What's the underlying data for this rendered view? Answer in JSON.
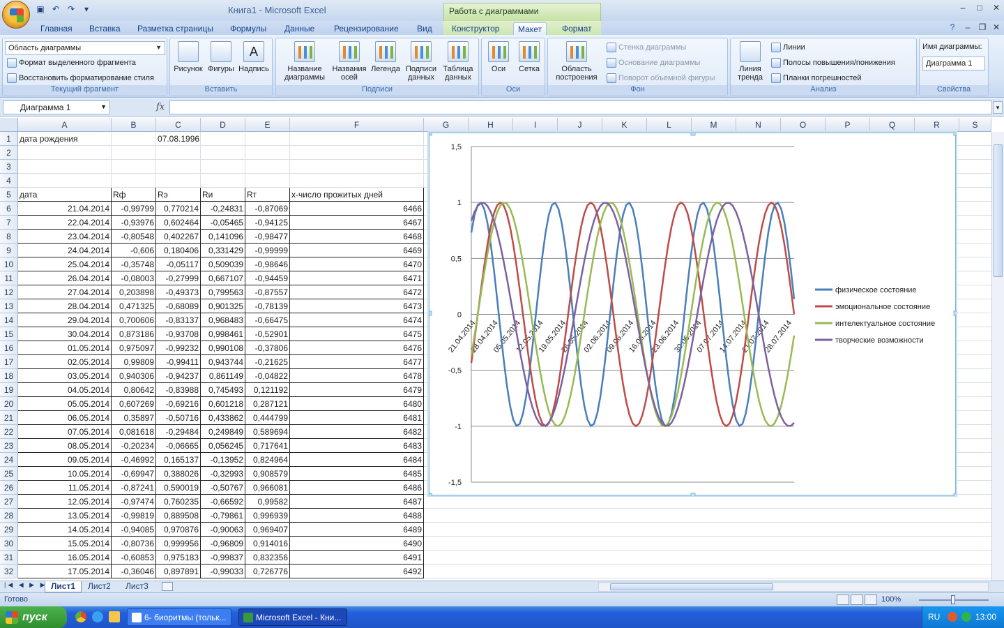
{
  "window": {
    "title": "Книга1 - Microsoft Excel",
    "context_group": "Работа с диаграммами"
  },
  "tabs": [
    "Главная",
    "Вставка",
    "Разметка страницы",
    "Формулы",
    "Данные",
    "Рецензирование",
    "Вид",
    "Конструктор",
    "Макет",
    "Формат"
  ],
  "active_tab": "Макет",
  "ribbon": {
    "current": {
      "selector_value": "Область диаграммы",
      "format_selection": "Формат выделенного фрагмента",
      "reset_style": "Восстановить форматирование стиля",
      "label": "Текущий фрагмент"
    },
    "insert": {
      "picture": "Рисунок",
      "shapes": "Фигуры",
      "textbox": "Надпись",
      "label": "Вставить"
    },
    "labels": {
      "chart_title": "Название диаграммы",
      "axis_titles": "Названия осей",
      "legend": "Легенда",
      "data_labels": "Подписи данных",
      "data_table": "Таблица данных",
      "label": "Подписи"
    },
    "axes": {
      "axes": "Оси",
      "gridlines": "Сетка",
      "label": "Оси"
    },
    "background": {
      "plot_area": "Область построения",
      "chart_wall": "Стенка диаграммы",
      "chart_floor": "Основание диаграммы",
      "rotation_3d": "Поворот объемной фигуры",
      "label": "Фон"
    },
    "analysis": {
      "trendline": "Линия тренда",
      "lines": "Линии",
      "updown_bars": "Полосы повышения/понижения",
      "error_bars": "Планки погрешностей",
      "label": "Анализ"
    },
    "properties": {
      "chart_name_label": "Имя диаграммы:",
      "chart_name_value": "Диаграмма 1",
      "label": "Свойства"
    }
  },
  "formula_bar": {
    "name_box": "Диаграмма 1",
    "fx": "fx",
    "formula": ""
  },
  "columns": [
    "A",
    "B",
    "C",
    "D",
    "E",
    "F",
    "G",
    "H",
    "I",
    "J",
    "K",
    "L",
    "M",
    "N",
    "O",
    "P",
    "Q",
    "R",
    "S"
  ],
  "sheet": {
    "a1": "дата рождения",
    "c1": "07.08.1996",
    "headers": [
      "дата",
      "Rф",
      "Rэ",
      "Rи",
      "Rт",
      "х-число прожитых дней"
    ],
    "rows": [
      [
        "21.04.2014",
        "-0,99799",
        "0,770214",
        "-0,24831",
        "-0,87069",
        "6466"
      ],
      [
        "22.04.2014",
        "-0,93976",
        "0,602464",
        "-0,05465",
        "-0,94125",
        "6467"
      ],
      [
        "23.04.2014",
        "-0,80548",
        "0,402267",
        "0,141096",
        "-0,98477",
        "6468"
      ],
      [
        "24.04.2014",
        "-0,606",
        "0,180406",
        "0,331429",
        "-0,99999",
        "6469"
      ],
      [
        "25.04.2014",
        "-0,35748",
        "-0,05117",
        "0,509039",
        "-0,98646",
        "6470"
      ],
      [
        "26.04.2014",
        "-0,08003",
        "-0,27999",
        "0,667107",
        "-0,94459",
        "6471"
      ],
      [
        "27.04.2014",
        "0,203898",
        "-0,49373",
        "0,799563",
        "-0,87557",
        "6472"
      ],
      [
        "28.04.2014",
        "0,471325",
        "-0,68089",
        "0,901325",
        "-0,78139",
        "6473"
      ],
      [
        "29.04.2014",
        "0,700606",
        "-0,83137",
        "0,968483",
        "-0,66475",
        "6474"
      ],
      [
        "30.04.2014",
        "0,873186",
        "-0,93708",
        "0,998461",
        "-0,52901",
        "6475"
      ],
      [
        "01.05.2014",
        "0,975097",
        "-0,99232",
        "0,990108",
        "-0,37806",
        "6476"
      ],
      [
        "02.05.2014",
        "0,99809",
        "-0,99411",
        "0,943744",
        "-0,21625",
        "6477"
      ],
      [
        "03.05.2014",
        "0,940306",
        "-0,94237",
        "0,861149",
        "-0,04822",
        "6478"
      ],
      [
        "04.05.2014",
        "0,80642",
        "-0,83988",
        "0,745493",
        "0,121192",
        "6479"
      ],
      [
        "05.05.2014",
        "0,607269",
        "-0,69216",
        "0,601218",
        "0,287121",
        "6480"
      ],
      [
        "06.05.2014",
        "0,35897",
        "-0,50716",
        "0,433862",
        "0,444799",
        "6481"
      ],
      [
        "07.05.2014",
        "0,081618",
        "-0,29484",
        "0,249849",
        "0,589694",
        "6482"
      ],
      [
        "08.05.2014",
        "-0,20234",
        "-0,06665",
        "0,056245",
        "0,717641",
        "6483"
      ],
      [
        "09.05.2014",
        "-0,46992",
        "0,165137",
        "-0,13952",
        "0,824964",
        "6484"
      ],
      [
        "10.05.2014",
        "-0,69947",
        "0,388026",
        "-0,32993",
        "0,908579",
        "6485"
      ],
      [
        "11.05.2014",
        "-0,87241",
        "0,590019",
        "-0,50767",
        "0,966081",
        "6486"
      ],
      [
        "12.05.2014",
        "-0,97474",
        "0,760235",
        "-0,66592",
        "0,99582",
        "6487"
      ],
      [
        "13.05.2014",
        "-0,99819",
        "0,889508",
        "-0,79861",
        "0,996939",
        "6488"
      ],
      [
        "14.05.2014",
        "-0,94085",
        "0,970876",
        "-0,90063",
        "0,969407",
        "6489"
      ],
      [
        "15.05.2014",
        "-0,80736",
        "0,999956",
        "-0,96809",
        "0,914016",
        "6490"
      ],
      [
        "16.05.2014",
        "-0,60853",
        "0,975183",
        "-0,99837",
        "0,832356",
        "6491"
      ],
      [
        "17.05.2014",
        "-0,36046",
        "0,897891",
        "-0,99033",
        "0,726776",
        "6492"
      ]
    ]
  },
  "sheet_tabs": [
    "Лист1",
    "Лист2",
    "Лист3"
  ],
  "active_sheet": "Лист1",
  "status": {
    "ready": "Готово",
    "zoom": "100%"
  },
  "taskbar": {
    "start": "пуск",
    "tasks": [
      "6- биоритмы (тольк...",
      "Microsoft Excel - Кни..."
    ],
    "lang": "RU",
    "clock": "13:00"
  },
  "chart_data": {
    "type": "line",
    "ylim": [
      -1.5,
      1.5
    ],
    "yticks": [
      "1,5",
      "1",
      "0,5",
      "0",
      "-0,5",
      "-1",
      "-1,5"
    ],
    "x_start_day": 6466,
    "x_count": 101,
    "x_tick_labels": [
      "21.04.2014",
      "28.04.2014",
      "05.05.2014",
      "12.05.2014",
      "19.05.2014",
      "26.05.2014",
      "02.06.2014",
      "09.06.2014",
      "16.06.2014",
      "23.06.2014",
      "30.06.2014",
      "07.07.2014",
      "14.07.2014",
      "21.07.2014",
      "28.07.2014"
    ],
    "series": [
      {
        "name": "физическое состояние",
        "period": 23,
        "color": "#4a7ebb"
      },
      {
        "name": "эмоциональное состояние",
        "period": 28,
        "color": "#be4b48"
      },
      {
        "name": "интелектуальное состояние",
        "period": 33,
        "color": "#98b954"
      },
      {
        "name": "творческие возможности",
        "period": 38,
        "color": "#7d60a0"
      }
    ],
    "legend": "right",
    "grid": true
  }
}
